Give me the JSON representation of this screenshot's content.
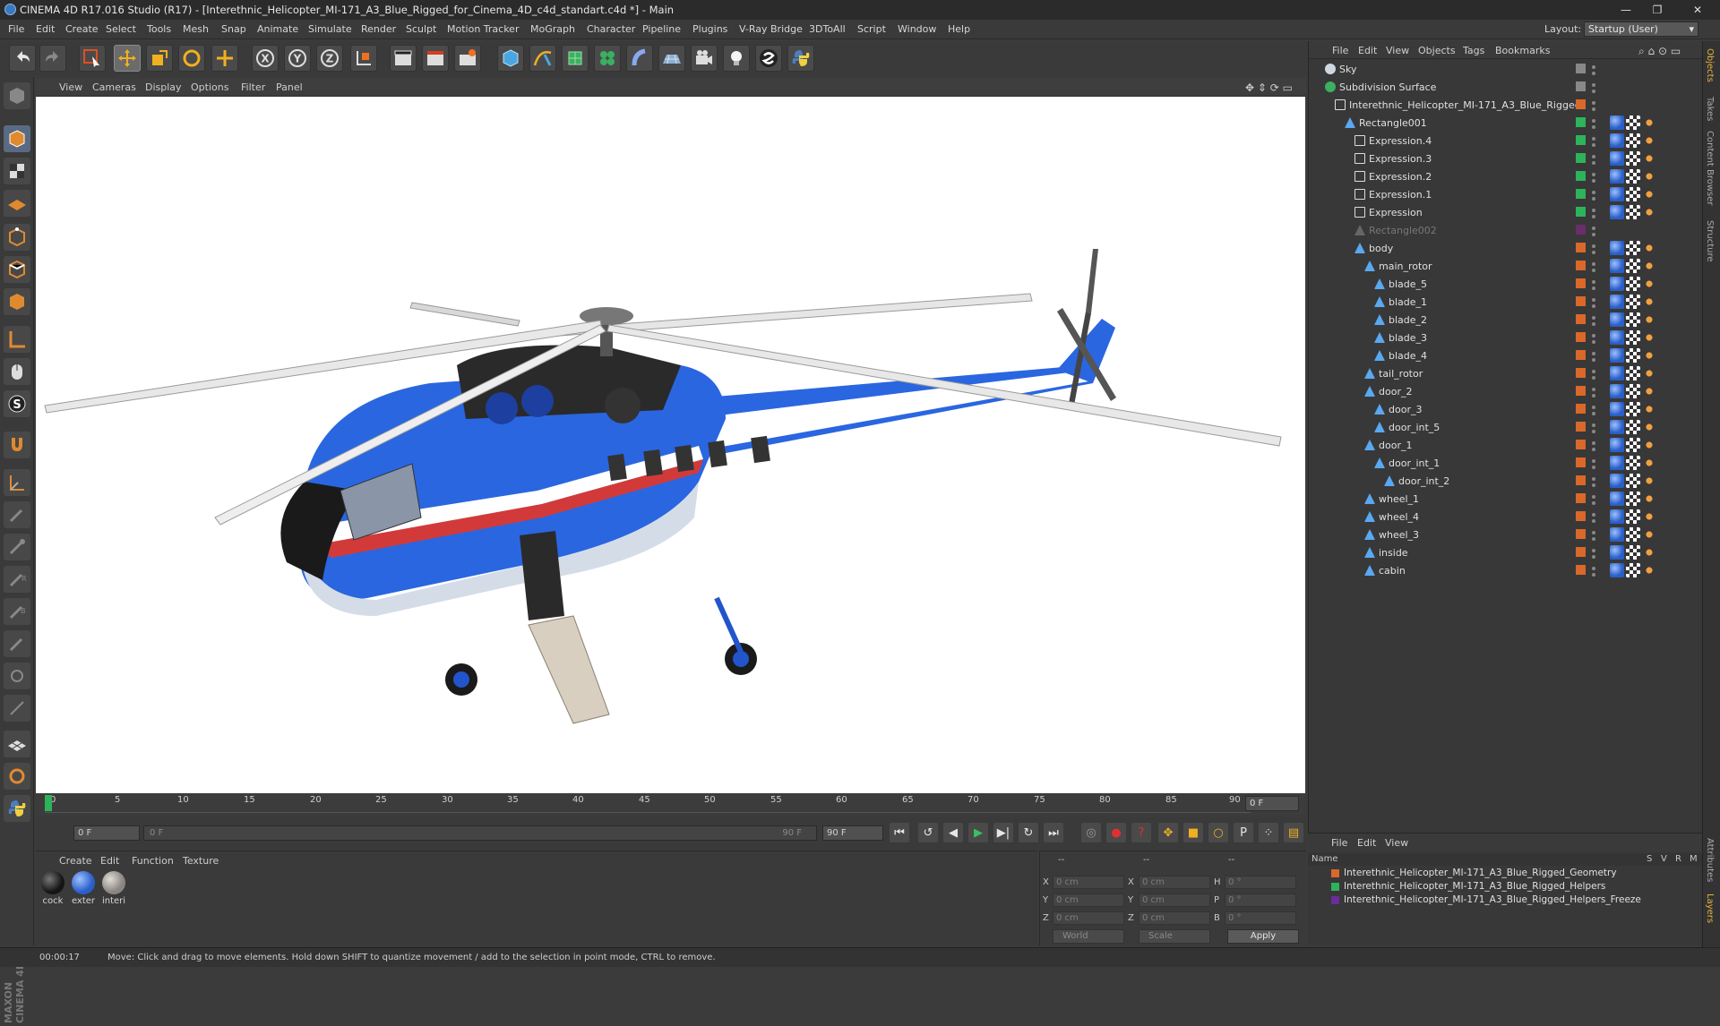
{
  "window": {
    "title": "CINEMA 4D R17.016 Studio (R17) - [Interethnic_Helicopter_MI-171_A3_Blue_Rigged_for_Cinema_4D_c4d_standart.c4d *] - Main",
    "controls": [
      "—",
      "❐",
      "✕"
    ]
  },
  "menu": [
    "File",
    "Edit",
    "Create",
    "Select",
    "Tools",
    "Mesh",
    "Snap",
    "Animate",
    "Simulate",
    "Render",
    "Sculpt",
    "Motion Tracker",
    "MoGraph",
    "Character",
    "Pipeline",
    "Plugins",
    "V-Ray Bridge",
    "3DToAll",
    "Script",
    "Window",
    "Help"
  ],
  "layout": {
    "label": "Layout:",
    "value": "Startup (User)"
  },
  "viewport": {
    "menu": [
      "View",
      "Cameras",
      "Display",
      "Options",
      "Filter",
      "Panel"
    ]
  },
  "timeline": {
    "ticks": [
      "0",
      "5",
      "10",
      "15",
      "20",
      "25",
      "30",
      "35",
      "40",
      "45",
      "50",
      "55",
      "60",
      "65",
      "70",
      "75",
      "80",
      "85",
      "90"
    ],
    "frame_field": "0 F"
  },
  "transport": {
    "start": "0 F",
    "range_start": "0 F",
    "range_end": "90 F",
    "end": "90 F"
  },
  "materials": {
    "menu": [
      "Create",
      "Edit",
      "Function",
      "Texture"
    ],
    "items": [
      {
        "label": "cock",
        "color": "#151515"
      },
      {
        "label": "exter",
        "color": "#2a5fc8"
      },
      {
        "label": "interi",
        "color": "#8a8580"
      }
    ]
  },
  "coords": {
    "x_pos": "0 cm",
    "y_pos": "0 cm",
    "z_pos": "0 cm",
    "x_size": "0 cm",
    "y_size": "0 cm",
    "z_size": "0 cm",
    "h": "0 °",
    "p": "0 °",
    "b": "0 °",
    "space": "World",
    "mode": "Scale",
    "apply": "Apply",
    "header1": "--",
    "header2": "--",
    "header3": "--"
  },
  "object_manager": {
    "menu": [
      "File",
      "Edit",
      "View",
      "Objects",
      "Tags",
      "Bookmarks"
    ],
    "objects": [
      {
        "name": "Sky",
        "indent": 0,
        "color": "#888888",
        "icon": "sky-icon"
      },
      {
        "name": "Subdivision Surface",
        "indent": 0,
        "color": "#888888",
        "icon": "subdivision-icon"
      },
      {
        "name": "Interethnic_Helicopter_MI-171_A3_Blue_Rigged",
        "indent": 1,
        "color": "#d9682a",
        "icon": "null-icon"
      },
      {
        "name": "Rectangle001",
        "indent": 2,
        "color": "#2db35a",
        "icon": "spline-icon"
      },
      {
        "name": "Expression.4",
        "indent": 3,
        "color": "#2db35a",
        "icon": "null-icon"
      },
      {
        "name": "Expression.3",
        "indent": 3,
        "color": "#2db35a",
        "icon": "null-icon"
      },
      {
        "name": "Expression.2",
        "indent": 3,
        "color": "#2db35a",
        "icon": "null-icon"
      },
      {
        "name": "Expression.1",
        "indent": 3,
        "color": "#2db35a",
        "icon": "null-icon"
      },
      {
        "name": "Expression",
        "indent": 3,
        "color": "#2db35a",
        "icon": "null-icon"
      },
      {
        "name": "Rectangle002",
        "indent": 3,
        "color": "#6a2d6a",
        "icon": "spline-icon",
        "dim": true
      },
      {
        "name": "body",
        "indent": 3,
        "color": "#d9682a",
        "icon": "polygon-icon"
      },
      {
        "name": "main_rotor",
        "indent": 4,
        "color": "#d9682a",
        "icon": "polygon-icon"
      },
      {
        "name": "blade_5",
        "indent": 5,
        "color": "#d9682a",
        "icon": "polygon-icon"
      },
      {
        "name": "blade_1",
        "indent": 5,
        "color": "#d9682a",
        "icon": "polygon-icon"
      },
      {
        "name": "blade_2",
        "indent": 5,
        "color": "#d9682a",
        "icon": "polygon-icon"
      },
      {
        "name": "blade_3",
        "indent": 5,
        "color": "#d9682a",
        "icon": "polygon-icon"
      },
      {
        "name": "blade_4",
        "indent": 5,
        "color": "#d9682a",
        "icon": "polygon-icon"
      },
      {
        "name": "tail_rotor",
        "indent": 4,
        "color": "#d9682a",
        "icon": "polygon-icon"
      },
      {
        "name": "door_2",
        "indent": 4,
        "color": "#d9682a",
        "icon": "polygon-icon"
      },
      {
        "name": "door_3",
        "indent": 5,
        "color": "#d9682a",
        "icon": "polygon-icon"
      },
      {
        "name": "door_int_5",
        "indent": 5,
        "color": "#d9682a",
        "icon": "polygon-icon"
      },
      {
        "name": "door_1",
        "indent": 4,
        "color": "#d9682a",
        "icon": "polygon-icon"
      },
      {
        "name": "door_int_1",
        "indent": 5,
        "color": "#d9682a",
        "icon": "polygon-icon"
      },
      {
        "name": "door_int_2",
        "indent": 6,
        "color": "#d9682a",
        "icon": "polygon-icon"
      },
      {
        "name": "wheel_1",
        "indent": 4,
        "color": "#d9682a",
        "icon": "polygon-icon"
      },
      {
        "name": "wheel_4",
        "indent": 4,
        "color": "#d9682a",
        "icon": "polygon-icon"
      },
      {
        "name": "wheel_3",
        "indent": 4,
        "color": "#d9682a",
        "icon": "polygon-icon"
      },
      {
        "name": "inside",
        "indent": 4,
        "color": "#d9682a",
        "icon": "polygon-icon"
      },
      {
        "name": "cabin",
        "indent": 4,
        "color": "#d9682a",
        "icon": "polygon-icon"
      }
    ]
  },
  "layer_manager": {
    "menu": [
      "File",
      "Edit",
      "View"
    ],
    "header": {
      "name": "Name",
      "s": "S",
      "v": "V",
      "r": "R",
      "m": "M"
    },
    "layers": [
      {
        "name": "Interethnic_Helicopter_MI-171_A3_Blue_Rigged_Geometry",
        "color": "#d9682a"
      },
      {
        "name": "Interethnic_Helicopter_MI-171_A3_Blue_Rigged_Helpers",
        "color": "#2db35a"
      },
      {
        "name": "Interethnic_Helicopter_MI-171_A3_Blue_Rigged_Helpers_Freeze",
        "color": "#6a2d9a"
      }
    ]
  },
  "right_tabs": [
    "Objects",
    "Takes",
    "Content Browser",
    "Structure",
    "Attributes",
    "Layers"
  ],
  "status": {
    "time": "00:00:17",
    "message": "Move: Click and drag to move elements. Hold down SHIFT to quantize movement / add to the selection in point mode, CTRL to remove."
  },
  "maxon_logo": "MAXON CINEMA 4D"
}
